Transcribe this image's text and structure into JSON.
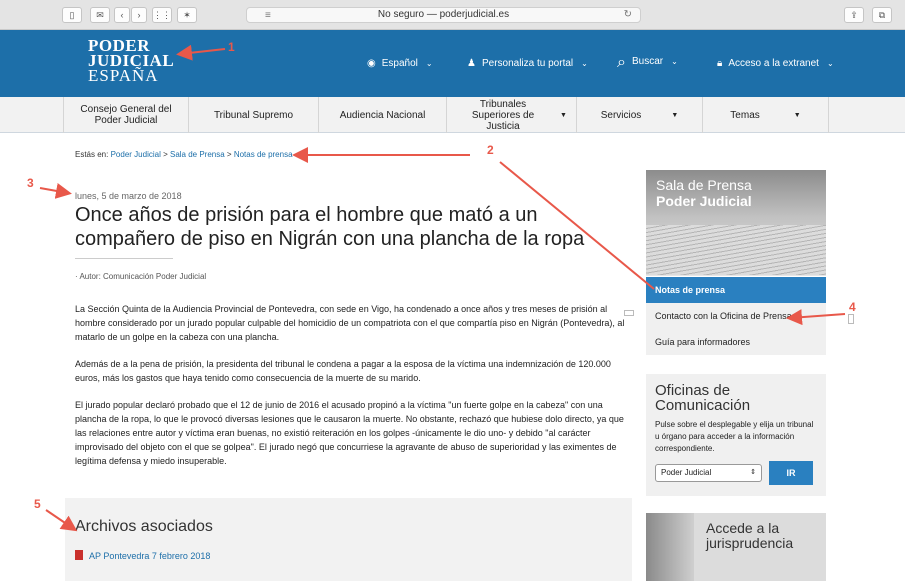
{
  "browser": {
    "url_text": "No seguro — poderjudicial.es"
  },
  "header": {
    "logo_line1": "PODER",
    "logo_line2": "JUDICIAL",
    "logo_line3": "ESPAÑA",
    "language": "Español",
    "personalize": "Personaliza tu portal",
    "search": "Buscar",
    "extranet": "Acceso a la extranet"
  },
  "nav": {
    "items": [
      {
        "label": "Consejo General del Poder Judicial"
      },
      {
        "label": "Tribunal Supremo"
      },
      {
        "label": "Audiencia Nacional"
      },
      {
        "label": "Tribunales Superiores de Justicia"
      },
      {
        "label": "Servicios"
      },
      {
        "label": "Temas"
      }
    ]
  },
  "breadcrumb": {
    "prefix": "Estás en:",
    "items": [
      "Poder Judicial",
      "Sala de Prensa",
      "Notas de prensa"
    ],
    "sep": ">"
  },
  "article": {
    "date": "lunes, 5 de marzo de 2018",
    "title": "Once años de prisión para el hombre que mató a un compañero de piso en Nigrán con una plancha de la ropa",
    "author": "· Autor: Comunicación Poder Judicial",
    "paragraphs": [
      "La Sección Quinta de la Audiencia Provincial de Pontevedra, con sede en Vigo, ha condenado a once años y tres meses de prisión al hombre considerado por un jurado popular culpable del homicidio de un compatriota con el que compartía piso en Nigrán (Pontevedra), al matarlo de un golpe en la cabeza con una plancha.",
      "Además de a la pena de prisión, la presidenta del tribunal le condena a pagar a la esposa de la víctima una indemnización de 120.000 euros, más los gastos que haya tenido como consecuencia de la muerte de su marido.",
      "El jurado popular declaró probado que el 12 de junio de 2016 el acusado propinó a la víctima \"un fuerte golpe en la cabeza\" con una plancha de la ropa, lo que le provocó diversas lesiones que le causaron la muerte. No obstante, rechazó que hubiese dolo directo, ya que las relaciones entre autor y víctima eran buenas, no existió reiteración en los golpes -únicamente le dio uno- y debido \"al carácter improvisado del objeto con el que se golpea\". El jurado negó que concurriese la agravante de abuso de superioridad y las eximentes de legítima defensa y miedo insuperable."
    ]
  },
  "files": {
    "heading": "Archivos asociados",
    "items": [
      "AP Pontevedra 7 febrero 2018"
    ]
  },
  "sidebar": {
    "hero_line1": "Sala de Prensa",
    "hero_line2": "Poder Judicial",
    "items": [
      "Notas de prensa",
      "Contacto con la Oficina de Prensa",
      "Guía para informadores"
    ],
    "office_title": "Oficinas de Comunicación",
    "office_text": "Pulse sobre el desplegable y elija un tribunal u órgano para acceder a la información correspondiente.",
    "office_select": "Poder Judicial",
    "office_button": "IR",
    "juris_title": "Accede a la jurisprudencia"
  },
  "annotations": [
    "1",
    "2",
    "3",
    "4",
    "5"
  ],
  "colors": {
    "brand_blue": "#1d6fa9",
    "accent_blue": "#2a80c0",
    "annotation": "#e8584a"
  }
}
